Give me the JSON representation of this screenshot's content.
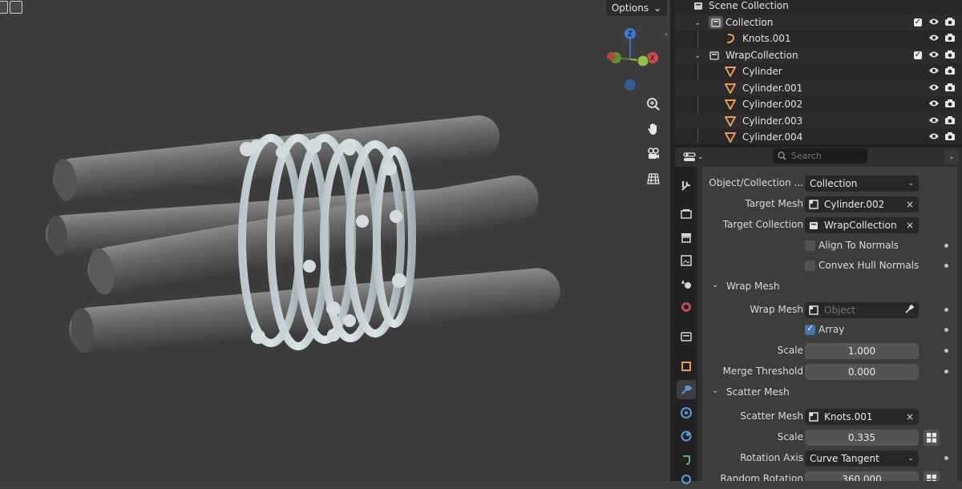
{
  "viewport": {
    "options_label": "Options",
    "gizmo_axes": [
      "Z",
      "Y",
      "X"
    ],
    "nav_icons": [
      "zoom-icon",
      "hand-pan-icon",
      "camera-view-icon",
      "ortho-grid-icon"
    ]
  },
  "outliner": {
    "rows": [
      {
        "label": "Scene Collection",
        "icon": "scene-collection-icon"
      },
      {
        "label": "Collection",
        "icon": "collection-icon",
        "checked": true
      },
      {
        "label": "Knots.001",
        "icon": "curve-icon"
      },
      {
        "label": "WrapCollection",
        "icon": "collection-icon",
        "checked": true
      },
      {
        "label": "Cylinder",
        "icon": "mesh-icon"
      },
      {
        "label": "Cylinder.001",
        "icon": "mesh-icon"
      },
      {
        "label": "Cylinder.002",
        "icon": "mesh-icon"
      },
      {
        "label": "Cylinder.003",
        "icon": "mesh-icon"
      },
      {
        "label": "Cylinder.004",
        "icon": "mesh-icon"
      }
    ]
  },
  "properties": {
    "search_placeholder": "Search",
    "object_collection_label": "Object/Collection ...",
    "object_collection_value": "Collection",
    "target_mesh_label": "Target Mesh",
    "target_mesh_value": "Cylinder.002",
    "target_collection_label": "Target Collection",
    "target_collection_value": "WrapCollection",
    "align_normals_label": "Align To Normals",
    "convex_hull_label": "Convex Hull Normals",
    "wrap_section": "Wrap Mesh",
    "wrap_mesh_label": "Wrap Mesh",
    "wrap_mesh_placeholder": "Object",
    "array_label": "Array",
    "scale_label": "Scale",
    "wrap_scale_value": "1.000",
    "merge_label": "Merge Threshold",
    "merge_value": "0.000",
    "scatter_section": "Scatter Mesh",
    "scatter_mesh_label": "Scatter Mesh",
    "scatter_mesh_value": "Knots.001",
    "scatter_scale_label": "Scale",
    "scatter_scale_value": "0.335",
    "rotation_axis_label": "Rotation Axis",
    "rotation_axis_value": "Curve Tangent",
    "random_rotation_label": "Random Rotation",
    "random_rotation_value": "360.000"
  },
  "colors": {
    "accent": "#4772b3",
    "mesh_icon": "#e89b4a",
    "viewport_bg": "#3c3c3c"
  }
}
